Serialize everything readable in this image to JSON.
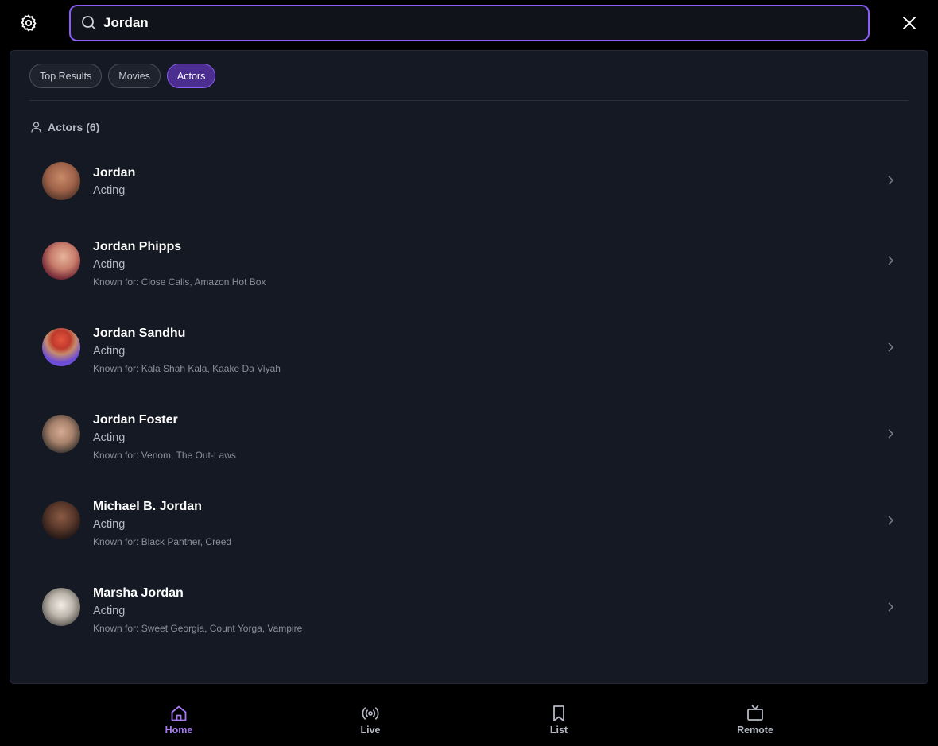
{
  "search": {
    "value": "Jordan",
    "placeholder": ""
  },
  "tabs": [
    {
      "label": "Top Results",
      "active": false
    },
    {
      "label": "Movies",
      "active": false
    },
    {
      "label": "Actors",
      "active": true
    }
  ],
  "section": {
    "label": "Actors (6)",
    "icon": "person-icon"
  },
  "actors": [
    {
      "name": "Jordan",
      "department": "Acting",
      "known_for": ""
    },
    {
      "name": "Jordan Phipps",
      "department": "Acting",
      "known_for": "Known for: Close Calls, Amazon Hot Box"
    },
    {
      "name": "Jordan Sandhu",
      "department": "Acting",
      "known_for": "Known for: Kala Shah Kala, Kaake Da Viyah"
    },
    {
      "name": "Jordan Foster",
      "department": "Acting",
      "known_for": "Known for: Venom, The Out-Laws"
    },
    {
      "name": "Michael B. Jordan",
      "department": "Acting",
      "known_for": "Known for: Black Panther, Creed"
    },
    {
      "name": "Marsha Jordan",
      "department": "Acting",
      "known_for": "Known for: Sweet Georgia, Count Yorga, Vampire"
    }
  ],
  "nav": [
    {
      "label": "Home",
      "icon": "home-icon",
      "active": true
    },
    {
      "label": "Live",
      "icon": "broadcast-icon",
      "active": false
    },
    {
      "label": "List",
      "icon": "bookmark-icon",
      "active": false
    },
    {
      "label": "Remote",
      "icon": "tv-icon",
      "active": false
    }
  ],
  "colors": {
    "accent": "#8b5cf6",
    "panel": "#151923",
    "background": "#000000"
  }
}
